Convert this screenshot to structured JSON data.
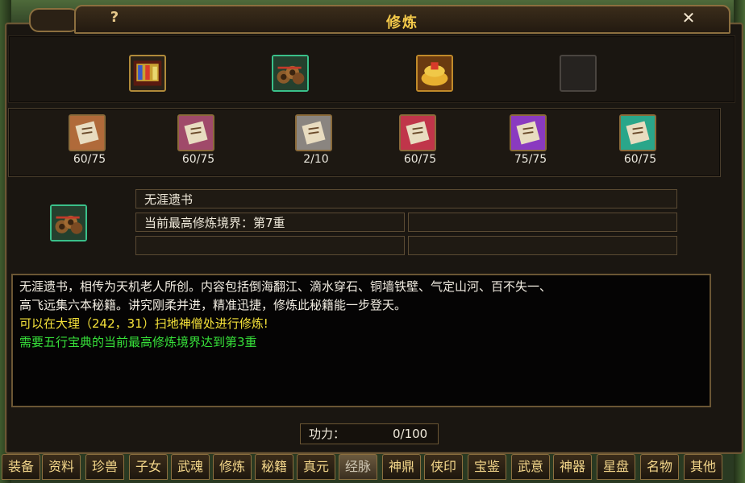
{
  "window": {
    "title": "修炼",
    "help_icon": "question-icon",
    "close_icon": "close-icon"
  },
  "top_items": [
    {
      "name": "tome-red-gold",
      "empty": false
    },
    {
      "name": "scroll-bundle",
      "empty": false
    },
    {
      "name": "golden-scroll-stack",
      "empty": false
    },
    {
      "name": "empty-slot",
      "empty": true
    }
  ],
  "manuals": [
    {
      "count": "60/75",
      "color": "#b06a3a"
    },
    {
      "count": "60/75",
      "color": "#a04a6a"
    },
    {
      "count": "2/10",
      "color": "#8a8580"
    },
    {
      "count": "60/75",
      "color": "#c0354a"
    },
    {
      "count": "75/75",
      "color": "#8a3ac0"
    },
    {
      "count": "60/75",
      "color": "#2aa68a"
    }
  ],
  "detail": {
    "book_name": "无涯遗书",
    "realm_label": "当前最高修炼境界：第7重"
  },
  "description": {
    "line1": "无涯遗书，相传为天机老人所创。内容包括倒海翻江、滴水穿石、铜墙铁壁、气定山河、百不失一、",
    "line2": "高飞远集六本秘籍。讲究刚柔并进，精准迅捷，修炼此秘籍能一步登天。",
    "location": "可以在大理（242，31）扫地神僧处进行修炼!",
    "requirement": "需要五行宝典的当前最高修炼境界达到第3重",
    "colors": {
      "normal": "#f2ede2",
      "location": "#f5e23a",
      "requirement": "#37e23a"
    }
  },
  "gongli": {
    "label": "功力：",
    "value": "0/100"
  },
  "tabs": [
    "装备",
    "资料",
    "珍兽",
    "子女",
    "武魂",
    "修炼",
    "秘籍",
    "真元",
    "经脉",
    "神鼎",
    "侠印",
    "宝鉴",
    "武意",
    "神器",
    "星盘",
    "名物",
    "其他"
  ],
  "active_tab": "经脉"
}
